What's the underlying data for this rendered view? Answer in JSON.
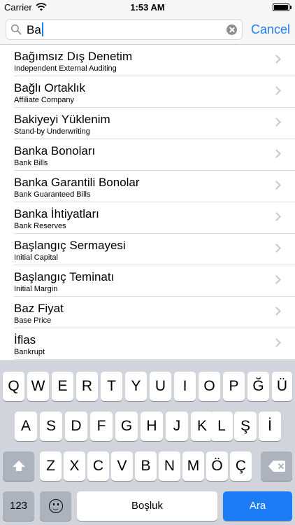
{
  "status_bar": {
    "carrier": "Carrier",
    "time": "1:53 AM",
    "icons": [
      "wifi-icon",
      "battery-icon"
    ]
  },
  "search": {
    "query": "Ba",
    "cancel_label": "Cancel",
    "accent_color": "#1f7bf6"
  },
  "results": [
    {
      "title": "Bağımsız Dış Denetim",
      "subtitle": "Independent External Auditing"
    },
    {
      "title": "Bağlı Ortaklık",
      "subtitle": "Affiliate Company"
    },
    {
      "title": "Bakiyeyi Yüklenim",
      "subtitle": "Stand-by Underwriting"
    },
    {
      "title": "Banka Bonoları",
      "subtitle": "Bank Bills"
    },
    {
      "title": "Banka Garantili Bonolar",
      "subtitle": "Bank Guaranteed Bills"
    },
    {
      "title": "Banka İhtiyatları",
      "subtitle": "Bank Reserves"
    },
    {
      "title": "Başlangıç Sermayesi",
      "subtitle": "Initial Capital"
    },
    {
      "title": "Başlangıç Teminatı",
      "subtitle": "Initial Margin"
    },
    {
      "title": "Baz Fiyat",
      "subtitle": "Base Price"
    },
    {
      "title": "İflas",
      "subtitle": "Bankrupt"
    }
  ],
  "keyboard": {
    "row1": [
      "Q",
      "W",
      "E",
      "R",
      "T",
      "Y",
      "U",
      "I",
      "O",
      "P",
      "Ğ",
      "Ü"
    ],
    "row2": [
      "A",
      "S",
      "D",
      "F",
      "G",
      "H",
      "J",
      "K",
      "L",
      "Ş",
      "İ"
    ],
    "row3": [
      "Z",
      "X",
      "C",
      "V",
      "B",
      "N",
      "M",
      "Ö",
      "Ç"
    ],
    "numbers_label": "123",
    "space_label": "Boşluk",
    "return_label": "Ara"
  }
}
